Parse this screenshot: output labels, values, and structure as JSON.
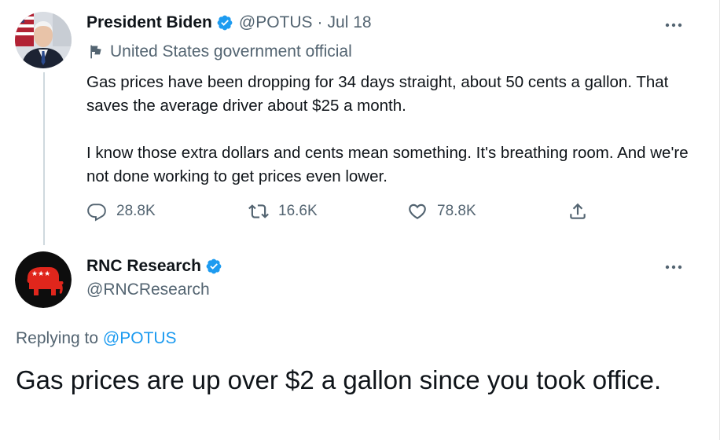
{
  "original_tweet": {
    "author_name": "President Biden",
    "handle": "@POTUS",
    "separator": "·",
    "date": "Jul 18",
    "label": "United States government official",
    "text_paragraph_1": "Gas prices have been dropping for 34 days straight, about 50 cents a gallon. That saves the average driver about $25 a month.",
    "text_paragraph_2": "I know those extra dollars and cents mean something. It's breathing room. And we're not done working to get prices even lower.",
    "replies": "28.8K",
    "retweets": "16.6K",
    "likes": "78.8K"
  },
  "reply_tweet": {
    "author_name": "RNC Research",
    "handle": "@RNCResearch",
    "replying_prefix": "Replying to",
    "replying_to": "@POTUS",
    "text": "Gas prices are up over $2 a gallon since you took office."
  },
  "icons": {
    "verified": "verified-badge-icon",
    "more": "more-options-icon",
    "gov_flag": "flag-icon",
    "reply": "reply-icon",
    "retweet": "retweet-icon",
    "like": "heart-icon",
    "share": "share-icon"
  },
  "colors": {
    "verified_blue": "#1d9bf0",
    "text_secondary": "#536471",
    "rnc_red": "#e0261c"
  }
}
